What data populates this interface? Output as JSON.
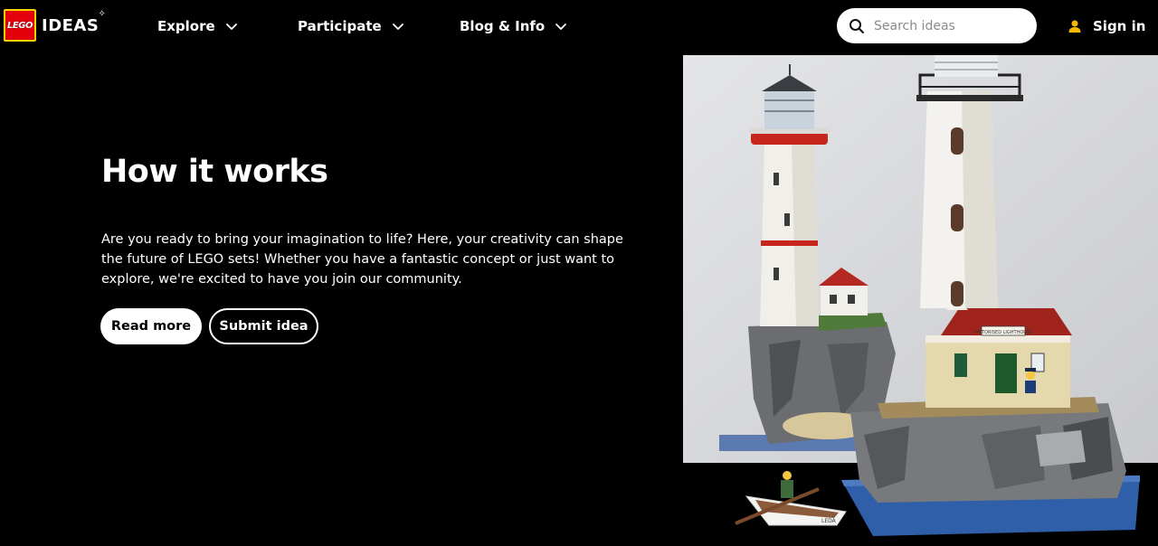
{
  "header": {
    "logo": {
      "badge_text": "LEGO",
      "wordmark": "IDEAS"
    },
    "nav": [
      {
        "label": "Explore",
        "icon": "chevron-down-icon"
      },
      {
        "label": "Participate",
        "icon": "chevron-down-icon"
      },
      {
        "label": "Blog & Info",
        "icon": "chevron-down-icon"
      }
    ],
    "search": {
      "placeholder": "Search ideas",
      "value": "",
      "icon": "search-icon"
    },
    "signin": {
      "label": "Sign in",
      "icon": "user-icon",
      "icon_color": "#f5b800"
    }
  },
  "hero": {
    "title": "How it works",
    "text": "Are you ready to bring your imagination to life? Here, your creativity can shape the future of LEGO sets! Whether you have a fantastic concept or just want to explore, we're excited to have you join our community.",
    "buttons": {
      "read_more": "Read more",
      "submit_idea": "Submit idea"
    },
    "image": {
      "sign_text": "MOTORISED LIGHTHOUSE",
      "boat_text": "LEDA"
    }
  },
  "colors": {
    "background": "#000000",
    "lego_red": "#e3000b",
    "lego_yellow": "#ffd500",
    "text": "#ffffff"
  }
}
